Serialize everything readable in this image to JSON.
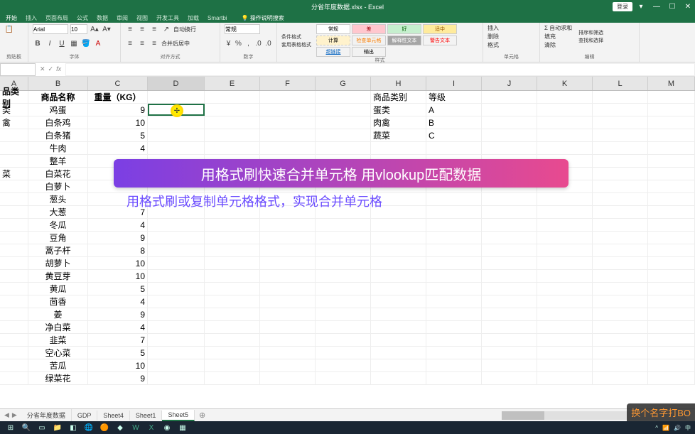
{
  "titlebar": {
    "title": "分省年度数据.xlsx - Excel",
    "login": "登录"
  },
  "tabs": [
    "开始",
    "插入",
    "页面布局",
    "公式",
    "数据",
    "审阅",
    "视图",
    "开发工具",
    "加载",
    "Smartbi"
  ],
  "tell_me": "操作说明搜索",
  "ribbon": {
    "font_name": "Arial",
    "font_size": "10",
    "wrap": "自动换行",
    "merge": "合并后居中",
    "number_fmt": "常规",
    "cond_fmt": "条件格式",
    "as_table": "套用表格格式",
    "styles": {
      "normal": "常规",
      "bad": "差",
      "good": "好",
      "neutral": "适中",
      "calc": "计算",
      "check": "检查单元格",
      "explain": "解释性文本",
      "warn": "警告文本",
      "link": "超链接",
      "output": "输出"
    },
    "insert": "插入",
    "delete": "删除",
    "format": "格式",
    "autosum": "自动求和",
    "fill": "填充",
    "clear": "清除",
    "sort": "排序和筛选",
    "find": "查找和选择",
    "g_clipboard": "剪贴板",
    "g_font": "字体",
    "g_align": "对齐方式",
    "g_number": "数字",
    "g_styles": "样式",
    "g_cells": "单元格",
    "g_edit": "编辑"
  },
  "namebox": "",
  "columns": [
    "A",
    "B",
    "C",
    "D",
    "E",
    "F",
    "G",
    "H",
    "I",
    "J",
    "K",
    "L",
    "M"
  ],
  "headers": {
    "a": "品类别",
    "b": "商品名称",
    "c": "重量（KG）"
  },
  "catA": [
    "类",
    "禽",
    "",
    "",
    "",
    "菜"
  ],
  "lookup": {
    "h1": "商品类别",
    "i1": "等级",
    "h2": "蛋类",
    "i2": "A",
    "h3": "肉禽",
    "i3": "B",
    "h4": "蔬菜",
    "i4": "C"
  },
  "items": [
    {
      "name": "鸡蛋",
      "w": "9"
    },
    {
      "name": "白条鸡",
      "w": "10"
    },
    {
      "name": "白条猪",
      "w": "5"
    },
    {
      "name": "牛肉",
      "w": "4"
    },
    {
      "name": "整羊",
      "w": ""
    },
    {
      "name": "白菜花",
      "w": ""
    },
    {
      "name": "白萝卜",
      "w": ""
    },
    {
      "name": "葱头",
      "w": ""
    },
    {
      "name": "大葱",
      "w": "7"
    },
    {
      "name": "冬瓜",
      "w": "4"
    },
    {
      "name": "豆角",
      "w": "9"
    },
    {
      "name": "蒿子杆",
      "w": "8"
    },
    {
      "name": "胡萝卜",
      "w": "10"
    },
    {
      "name": "黄豆芽",
      "w": "10"
    },
    {
      "name": "黄瓜",
      "w": "5"
    },
    {
      "name": "茴香",
      "w": "4"
    },
    {
      "name": "姜",
      "w": "9"
    },
    {
      "name": "净白菜",
      "w": "4"
    },
    {
      "name": "韭菜",
      "w": "7"
    },
    {
      "name": "空心菜",
      "w": "5"
    },
    {
      "name": "苦瓜",
      "w": "10"
    },
    {
      "name": "绿菜花",
      "w": "9"
    }
  ],
  "banner": "用格式刷快速合并单元格 用vlookup匹配数据",
  "subbanner": "用格式刷或复制单元格格式，实现合并单元格",
  "corner": "换个名字打BO",
  "sheets": [
    "分省年度数据",
    "GDP",
    "Sheet4",
    "Sheet1",
    "Sheet5"
  ],
  "active_sheet": 4
}
